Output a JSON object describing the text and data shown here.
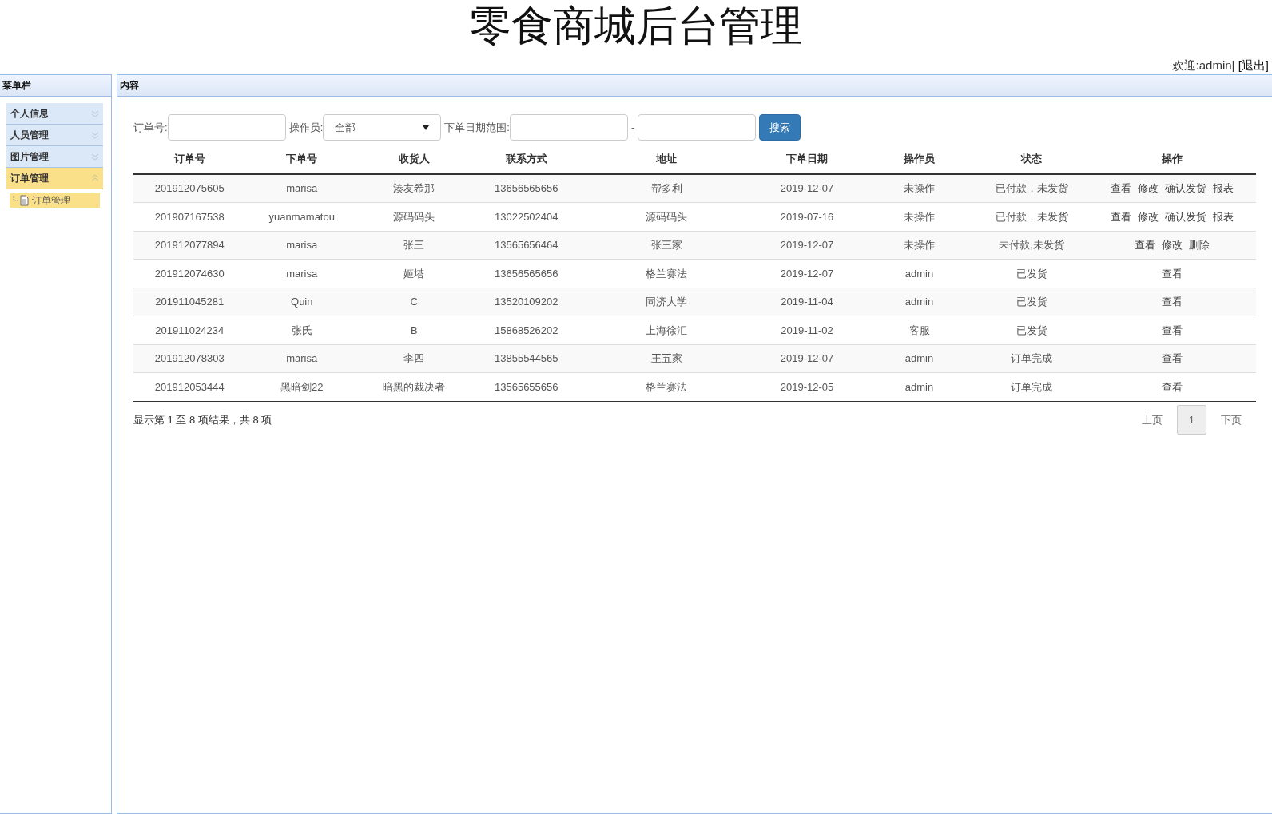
{
  "header": {
    "title": "零食商城后台管理",
    "welcome": "欢迎:admin|",
    "logout": "[退出]"
  },
  "sidebar": {
    "title": "菜单栏",
    "items": [
      {
        "label": "个人信息",
        "selected": false,
        "expanded": false
      },
      {
        "label": "人员管理",
        "selected": false,
        "expanded": false
      },
      {
        "label": "图片管理",
        "selected": false,
        "expanded": false
      },
      {
        "label": "订单管理",
        "selected": true,
        "expanded": true,
        "children": [
          {
            "label": "订单管理",
            "selected": true
          }
        ]
      }
    ]
  },
  "content": {
    "title": "内容",
    "filters": {
      "order_no_label": "订单号:",
      "operator_label": "操作员:",
      "operator_value": "全部",
      "date_label": "下单日期范围:",
      "date_separator": "-",
      "search_button": "搜索"
    },
    "table": {
      "columns": [
        "订单号",
        "下单号",
        "收货人",
        "联系方式",
        "地址",
        "下单日期",
        "操作员",
        "状态",
        "操作"
      ],
      "rows": [
        {
          "cells": [
            "201912075605",
            "marisa",
            "湊友希那",
            "13656565656",
            "帮多利",
            "2019-12-07",
            "未操作",
            "已付款，未发货"
          ],
          "actions": [
            "查看",
            "修改",
            "确认发货",
            "报表"
          ]
        },
        {
          "cells": [
            "201907167538",
            "yuanmamatou",
            "源码码头",
            "13022502404",
            "源码码头",
            "2019-07-16",
            "未操作",
            "已付款，未发货"
          ],
          "actions": [
            "查看",
            "修改",
            "确认发货",
            "报表"
          ]
        },
        {
          "cells": [
            "201912077894",
            "marisa",
            "张三",
            "13565656464",
            "张三家",
            "2019-12-07",
            "未操作",
            "未付款,未发货"
          ],
          "actions": [
            "查看",
            "修改",
            "删除"
          ]
        },
        {
          "cells": [
            "201912074630",
            "marisa",
            "姬塔",
            "13656565656",
            "格兰赛法",
            "2019-12-07",
            "admin",
            "已发货"
          ],
          "actions": [
            "查看"
          ]
        },
        {
          "cells": [
            "201911045281",
            "Quin",
            "C",
            "13520109202",
            "同济大学",
            "2019-11-04",
            "admin",
            "已发货"
          ],
          "actions": [
            "查看"
          ]
        },
        {
          "cells": [
            "201911024234",
            "张氏",
            "B",
            "15868526202",
            "上海徐汇",
            "2019-11-02",
            "客服",
            "已发货"
          ],
          "actions": [
            "查看"
          ]
        },
        {
          "cells": [
            "201912078303",
            "marisa",
            "李四",
            "13855544565",
            "王五家",
            "2019-12-07",
            "admin",
            "订单完成"
          ],
          "actions": [
            "查看"
          ]
        },
        {
          "cells": [
            "201912053444",
            "黑暗剑22",
            "暗黑的裁决者",
            "13565655656",
            "格兰赛法",
            "2019-12-05",
            "admin",
            "订单完成"
          ],
          "actions": [
            "查看"
          ]
        }
      ]
    },
    "summary": "显示第 1 至 8 项结果，共 8 项",
    "pagination": {
      "prev": "上页",
      "next": "下页",
      "pages": [
        {
          "label": "1",
          "selected": true
        }
      ]
    }
  }
}
